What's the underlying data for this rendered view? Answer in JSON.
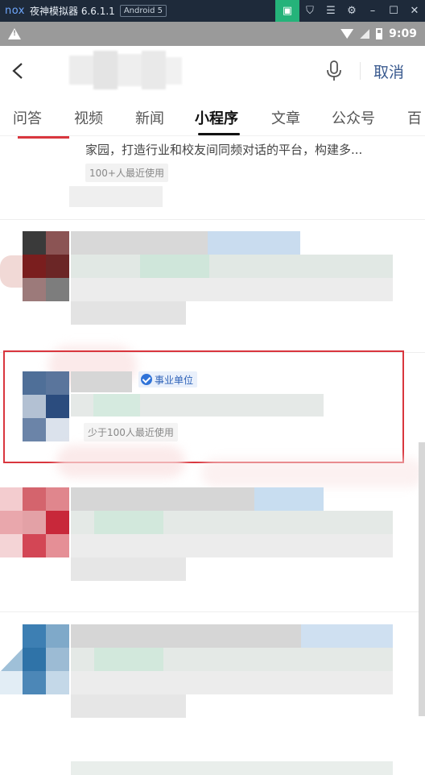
{
  "emulator": {
    "logo": "nox",
    "title": "夜神模拟器 6.6.1.1",
    "badge": "Android 5",
    "icons": [
      "store-icon",
      "shirt-icon",
      "menu-icon",
      "gear-icon",
      "minimize-icon",
      "maximize-icon",
      "close-icon"
    ]
  },
  "status_bar": {
    "time": "9:09"
  },
  "search": {
    "query_value": "",
    "cancel_label": "取消"
  },
  "tabs": [
    {
      "label": "问答"
    },
    {
      "label": "视频"
    },
    {
      "label": "新闻"
    },
    {
      "label": "小程序",
      "active": true
    },
    {
      "label": "文章"
    },
    {
      "label": "公众号"
    },
    {
      "label": "百"
    }
  ],
  "results": {
    "first": {
      "description": "家园，打造行业和校友间同频对话的平台，构建多...",
      "usage": "100+人最近使用"
    },
    "highlighted": {
      "badge": "事业单位",
      "usage": "少于100人最近使用"
    }
  },
  "colors": {
    "emulator_bg": "#1e2a3a",
    "status_bar_bg": "#9a9a9a",
    "accent_blue": "#3a5a8f",
    "highlight_red": "#d9363e",
    "verified_blue": "#2f73d8"
  }
}
